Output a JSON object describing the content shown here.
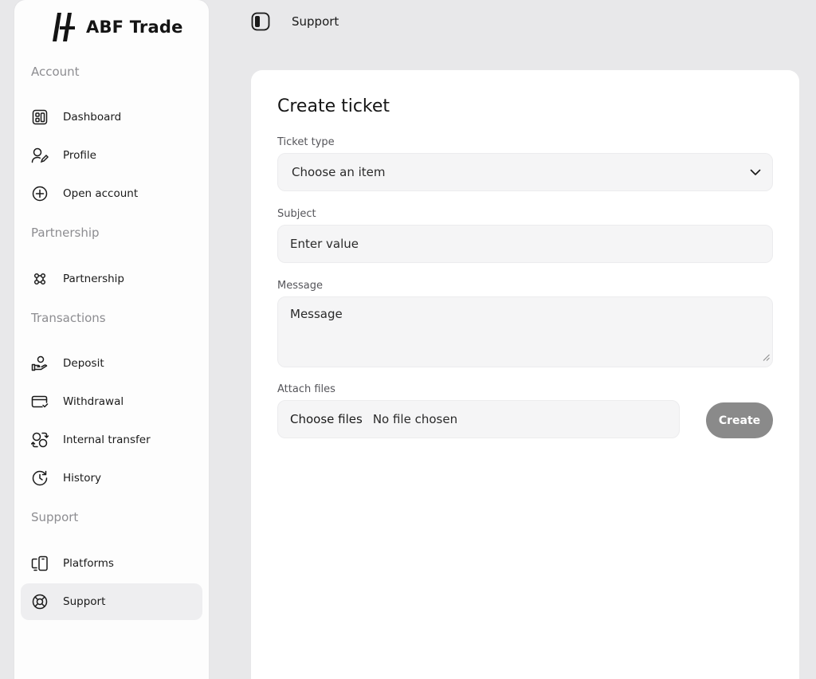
{
  "brand": {
    "name": "ABF Trade"
  },
  "sidebar": {
    "sections": [
      {
        "title": "Account"
      },
      {
        "title": "Partnership"
      },
      {
        "title": "Transactions"
      },
      {
        "title": "Support"
      }
    ],
    "items": [
      {
        "label": "Dashboard",
        "icon": "dashboard-icon"
      },
      {
        "label": "Profile",
        "icon": "profile-icon"
      },
      {
        "label": "Open account",
        "icon": "plus-circle-icon"
      },
      {
        "label": "Partnership",
        "icon": "partnership-icon"
      },
      {
        "label": "Deposit",
        "icon": "deposit-icon"
      },
      {
        "label": "Withdrawal",
        "icon": "card-icon"
      },
      {
        "label": "Internal transfer",
        "icon": "transfer-icon"
      },
      {
        "label": "History",
        "icon": "history-icon"
      },
      {
        "label": "Platforms",
        "icon": "devices-icon"
      },
      {
        "label": "Support",
        "icon": "lifebuoy-icon",
        "active": true
      }
    ]
  },
  "header": {
    "title": "Support",
    "toggle_icon": "sidebar-toggle-icon"
  },
  "form": {
    "title": "Create ticket",
    "ticket_type": {
      "label": "Ticket type",
      "value": "Choose an item"
    },
    "subject": {
      "label": "Subject",
      "placeholder": "Enter value"
    },
    "message": {
      "label": "Message",
      "placeholder": "Message"
    },
    "attach": {
      "label": "Attach files",
      "button": "Choose files",
      "status": "No file chosen"
    },
    "submit_label": "Create"
  },
  "colors": {
    "background": "#e8e8ea",
    "active_item": "#eeeef0",
    "button_disabled": "#8a8a8a"
  }
}
